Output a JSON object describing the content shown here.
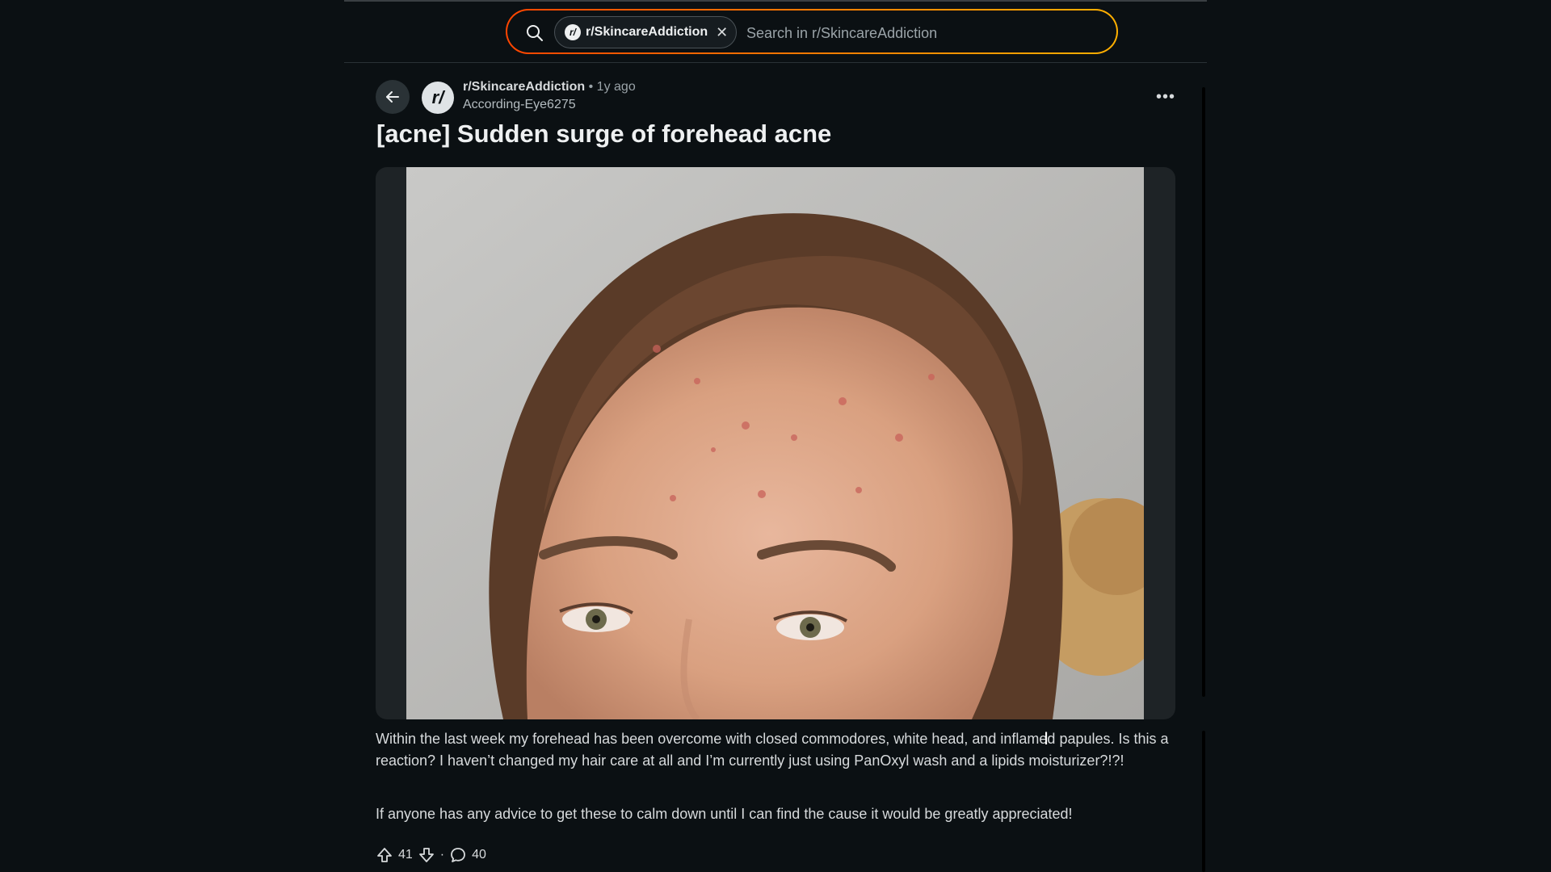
{
  "search": {
    "chip_label": "r/SkincareAddiction",
    "chip_icon": "r/",
    "close_glyph": "✕",
    "placeholder": "Search in r/SkincareAddiction",
    "value": ""
  },
  "post": {
    "subreddit": "r/SkincareAddiction",
    "avatar_text": "r/",
    "separator": "•",
    "age": "1y ago",
    "author": "According-Eye6275",
    "title": "[acne] Sudden surge of forehead acne",
    "more_label": "•••",
    "body": [
      "Within the last week my forehead has been overcome with closed commodores, white head, and inflamed papules. Is this a reaction? I haven’t changed my hair care at all and I’m currently just using PanOxyl wash and a lipids moisturizer?!?!",
      "If anyone has any advice to get these to calm down until I can find the cause it would be greatly appreciated!"
    ],
    "upvotes": "41",
    "dot": "·",
    "comments": "40"
  },
  "colors": {
    "background": "#0b1013",
    "accent_gradient_start": "#ff4500",
    "accent_gradient_end": "#ffb000",
    "text": "#d7dadc"
  },
  "icons": {
    "search": "search-icon",
    "back": "arrow-left-icon",
    "upvote": "upvote-arrow-icon",
    "downvote": "downvote-arrow-icon",
    "comment": "comment-bubble-icon",
    "text_cursor": "text-cursor-icon"
  }
}
